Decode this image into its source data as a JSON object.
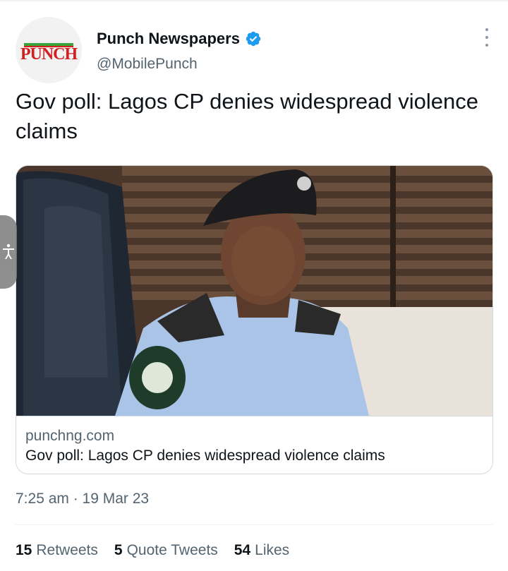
{
  "author": {
    "display_name": "Punch Newspapers",
    "handle": "@MobilePunch",
    "avatar_logo_text": "PUNCH",
    "verified": true
  },
  "tweet": {
    "text": "Gov poll: Lagos CP denies widespread violence claims",
    "timestamp": "7:25 am · 19 Mar 23"
  },
  "link_card": {
    "domain": "punchng.com",
    "title": "Gov poll: Lagos CP denies widespread violence claims"
  },
  "stats": [
    {
      "count": "15",
      "label": "Retweets"
    },
    {
      "count": "5",
      "label": "Quote Tweets"
    },
    {
      "count": "54",
      "label": "Likes"
    }
  ],
  "icons": {
    "verified": "verified-badge-icon",
    "more": "more-options-icon",
    "accessibility": "accessibility-icon"
  },
  "colors": {
    "text_primary": "#0f1419",
    "text_secondary": "#536471",
    "verified_blue": "#1d9bf0",
    "border": "#cfd9de"
  }
}
